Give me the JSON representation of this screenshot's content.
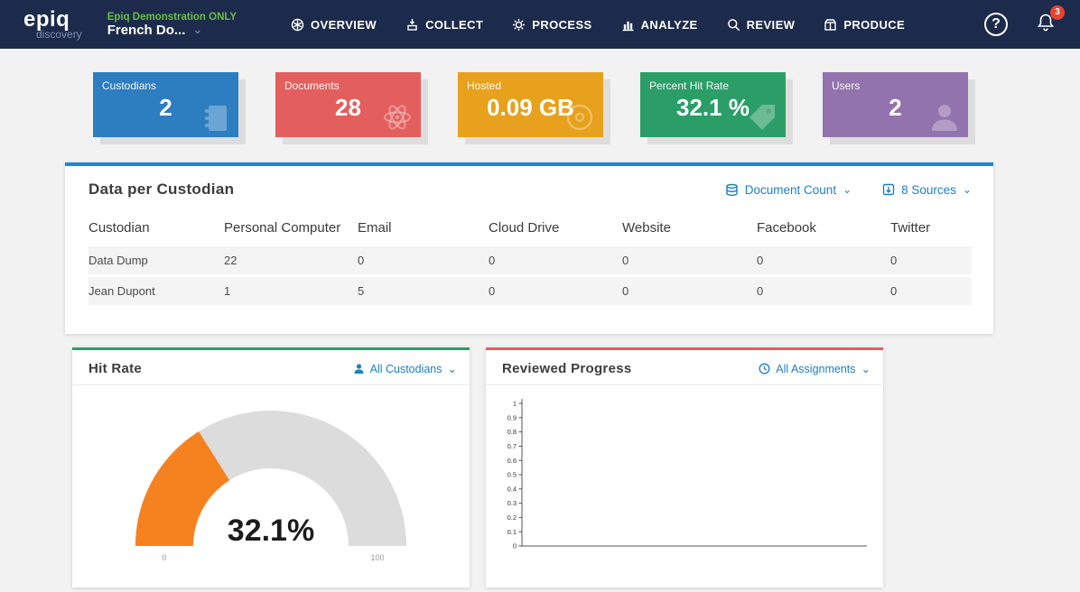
{
  "nav": {
    "logo": {
      "brand": "epiq",
      "sub": "discovery"
    },
    "project": {
      "env_label": "Epiq Demonstration ONLY",
      "name": "French Do...",
      "chevron": "⌄"
    },
    "items": [
      {
        "label": "OVERVIEW"
      },
      {
        "label": "COLLECT"
      },
      {
        "label": "PROCESS"
      },
      {
        "label": "ANALYZE"
      },
      {
        "label": "REVIEW"
      },
      {
        "label": "PRODUCE"
      }
    ],
    "help_glyph": "?",
    "notifications_count": "3",
    "colors": {
      "bar": "#1c2b4c",
      "env_label": "#6abd45",
      "link": "#1d7fc4"
    }
  },
  "stats": [
    {
      "label": "Custodians",
      "value": "2",
      "color": "#2d7dc1",
      "icon": "notebook-icon"
    },
    {
      "label": "Documents",
      "value": "28",
      "color": "#e35f5e",
      "icon": "atom-icon"
    },
    {
      "label": "Hosted",
      "value": "0.09 GB",
      "color": "#e7a11c",
      "icon": "database-icon"
    },
    {
      "label": "Percent Hit Rate",
      "value": "32.1 %",
      "color": "#2b9e68",
      "icon": "tag-icon"
    },
    {
      "label": "Users",
      "value": "2",
      "color": "#9373ad",
      "icon": "user-icon"
    }
  ],
  "custodian_panel": {
    "title": "Data per Custodian",
    "accent": "#1e87d5",
    "metric_dropdown": {
      "label": "Document Count",
      "icon": "stacked-discs-icon",
      "chevron": "⌄"
    },
    "sources_dropdown": {
      "label": "8 Sources",
      "icon": "source-box-icon",
      "chevron": "⌄"
    },
    "table": {
      "headers": [
        "Custodian",
        "Personal Computer",
        "Email",
        "Cloud Drive",
        "Website",
        "Facebook",
        "Twitter"
      ],
      "rows": [
        [
          "Data Dump",
          "22",
          "0",
          "0",
          "0",
          "0",
          "0"
        ],
        [
          "Jean Dupont",
          "1",
          "5",
          "0",
          "0",
          "0",
          "0"
        ]
      ]
    }
  },
  "hit_rate_panel": {
    "title": "Hit Rate",
    "accent": "#2b9e68",
    "dropdown": {
      "label": "All Custodians",
      "icon": "person-icon",
      "chevron": "⌄"
    }
  },
  "reviewed_panel": {
    "title": "Reviewed Progress",
    "accent": "#e35f5e",
    "dropdown": {
      "label": "All Assignments",
      "icon": "clock-icon",
      "chevron": "⌄"
    }
  },
  "chart_data": [
    {
      "type": "gauge",
      "title": "Hit Rate",
      "value": 32.1,
      "min": 0,
      "max": 100,
      "label": "32.1%",
      "fill_color": "#f5821f",
      "track_color": "#dcdcdc"
    },
    {
      "type": "line",
      "title": "Reviewed Progress",
      "x": [],
      "series": [],
      "ylim": [
        0,
        1
      ],
      "yticks": [
        0,
        0.1,
        0.2,
        0.3,
        0.4,
        0.5,
        0.6,
        0.7,
        0.8,
        0.9,
        1
      ]
    }
  ]
}
